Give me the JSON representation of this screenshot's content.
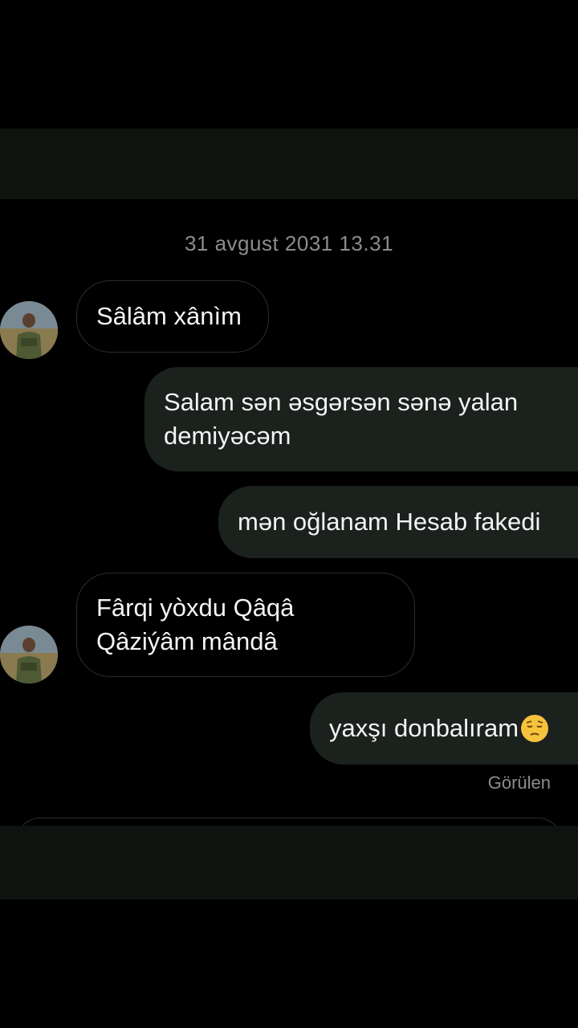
{
  "conversation": {
    "timestamp": "31 avgust 2031 13.31",
    "messages": [
      {
        "direction": "incoming",
        "text": "Sâlâm xânìm"
      },
      {
        "direction": "outgoing",
        "text": "Salam sən əsgərsən sənə yalan demiyəcəm"
      },
      {
        "direction": "outgoing",
        "text": "mən oğlanam Hesab fakedi"
      },
      {
        "direction": "incoming",
        "text": "Fârqi yòxdu Qâqâ Qâziýâm mândâ"
      },
      {
        "direction": "outgoing",
        "text": "yaxşı donbalıram",
        "emoji": "pensive-face-emoji"
      }
    ],
    "seen_label": "Görülen"
  },
  "avatar": {
    "icon": "soldier-avatar"
  },
  "colors": {
    "background": "#000000",
    "outgoing_bubble": "#1b211d",
    "incoming_border": "#2a2e2b",
    "bars": "#0e1310",
    "meta_text": "#8c8c8c"
  }
}
